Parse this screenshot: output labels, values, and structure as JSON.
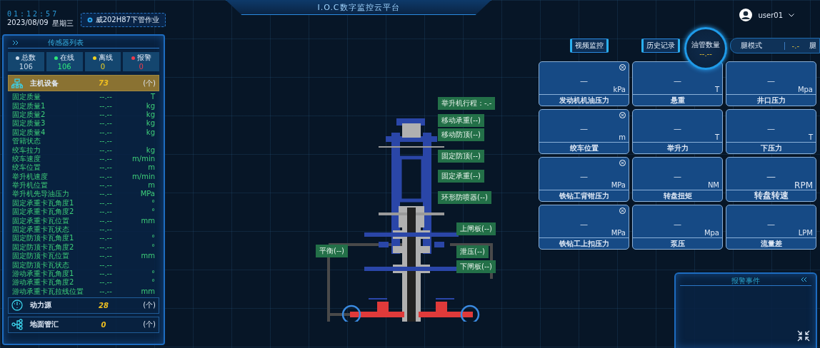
{
  "header": {
    "time": "01:12:57",
    "date": "2023/08/09",
    "weekday": "星期三",
    "location": "威202H87下管作业",
    "title": "I.O.C数字监控云平台",
    "user": "user01"
  },
  "sensor_panel": {
    "title": "传感器列表",
    "stats": [
      {
        "label": "总数",
        "value": "106",
        "color": "#c8d8e8"
      },
      {
        "label": "在线",
        "value": "106",
        "color": "#2ee87a"
      },
      {
        "label": "离线",
        "value": "0",
        "color": "#f0d020"
      },
      {
        "label": "报警",
        "value": "0",
        "color": "#f03a4a"
      }
    ],
    "groups": [
      {
        "kind": "host",
        "name": "主机设备",
        "count": "73",
        "unit": "(个)",
        "expanded": true,
        "rows": [
          {
            "name": "固定质量",
            "value": "--.--",
            "unit": "T"
          },
          {
            "name": "固定质量1",
            "value": "--.--",
            "unit": "kg"
          },
          {
            "name": "固定质量2",
            "value": "--.--",
            "unit": "kg"
          },
          {
            "name": "固定质量3",
            "value": "--.--",
            "unit": "kg"
          },
          {
            "name": "固定质量4",
            "value": "--.--",
            "unit": "kg"
          },
          {
            "name": "管籍状态",
            "value": "--.--"
          },
          {
            "name": "绞车拉力",
            "value": "--.--",
            "unit": "kg"
          },
          {
            "name": "绞车速度",
            "value": "--.--",
            "unit": "m/min"
          },
          {
            "name": "绞车位置",
            "value": "--.--",
            "unit": "m"
          },
          {
            "name": "举升机速度",
            "value": "--.--",
            "unit": "m/min"
          },
          {
            "name": "举升机位置",
            "value": "--.--",
            "unit": "m"
          },
          {
            "name": "举升机先导油压力",
            "value": "--.--",
            "unit": "MPa"
          },
          {
            "name": "固定承重卡瓦角度1",
            "value": "--.--",
            "unit": "°"
          },
          {
            "name": "固定承重卡瓦角度2",
            "value": "--.--",
            "unit": "°"
          },
          {
            "name": "固定承重卡瓦位置",
            "value": "--.--",
            "unit": "mm"
          },
          {
            "name": "固定承重卡瓦状态",
            "value": "--.--"
          },
          {
            "name": "固定防顶卡瓦角度1",
            "value": "--.--",
            "unit": "°"
          },
          {
            "name": "固定防顶卡瓦角度2",
            "value": "--.--",
            "unit": "°"
          },
          {
            "name": "固定防顶卡瓦位置",
            "value": "--.--",
            "unit": "mm"
          },
          {
            "name": "固定防顶卡瓦状态",
            "value": "--.--"
          },
          {
            "name": "游动承重卡瓦角度1",
            "value": "--.--",
            "unit": "°"
          },
          {
            "name": "游动承重卡瓦角度2",
            "value": "--.--",
            "unit": "°"
          },
          {
            "name": "游动承重卡瓦拉线位置",
            "value": "--.--",
            "unit": "mm"
          }
        ]
      },
      {
        "kind": "power",
        "name": "动力源",
        "count": "28",
        "unit": "(个)",
        "expanded": false
      },
      {
        "kind": "manifold",
        "name": "地面管汇",
        "count": "0",
        "unit": "(个)",
        "expanded": false
      }
    ]
  },
  "diagram": {
    "labels": [
      {
        "text": "举升机行程：-.-"
      },
      {
        "text": "移动承重(--)"
      },
      {
        "text": "移动防顶(--)"
      },
      {
        "text": "固定防顶(--)"
      },
      {
        "text": "固定承重(--)"
      },
      {
        "text": "环形防喷器(--)"
      },
      {
        "text": "上闸板(--)"
      },
      {
        "text": "平衡(--)"
      },
      {
        "text": "泄压(--)"
      },
      {
        "text": "下闸板(--)"
      }
    ]
  },
  "toolbar": {
    "buttons": [
      "视频监控",
      "历史记录"
    ],
    "gauge": {
      "label": "油管数量",
      "value": "--.--"
    },
    "mode": {
      "label": "腿模式",
      "value": "-.-",
      "unit": "腿"
    }
  },
  "cards": [
    {
      "value": "—",
      "unit": "kPa",
      "label": "发动机机油压力",
      "closable": true,
      "large": false
    },
    {
      "value": "—",
      "unit": "T",
      "label": "悬重",
      "closable": false,
      "large": false
    },
    {
      "value": "—",
      "unit": "Mpa",
      "label": "井口压力",
      "closable": false,
      "large": false
    },
    {
      "value": "—",
      "unit": "m",
      "label": "绞车位置",
      "closable": true,
      "large": false
    },
    {
      "value": "—",
      "unit": "T",
      "label": "举升力",
      "closable": false,
      "large": false
    },
    {
      "value": "—",
      "unit": "T",
      "label": "下压力",
      "closable": false,
      "large": false
    },
    {
      "value": "—",
      "unit": "MPa",
      "label": "铁钻工背钳压力",
      "closable": true,
      "large": false
    },
    {
      "value": "—",
      "unit": "NM",
      "label": "转盘扭矩",
      "closable": false,
      "large": false
    },
    {
      "value": "—",
      "unit": "RPM",
      "label": "转盘转速",
      "closable": false,
      "large": true
    },
    {
      "value": "—",
      "unit": "MPa",
      "label": "铁钻工上扣压力",
      "closable": true,
      "large": false
    },
    {
      "value": "—",
      "unit": "Mpa",
      "label": "泵压",
      "closable": false,
      "large": false
    },
    {
      "value": "—",
      "unit": "LPM",
      "label": "流量差",
      "closable": false,
      "large": false
    }
  ],
  "alarm_panel": {
    "title": "报警事件"
  }
}
